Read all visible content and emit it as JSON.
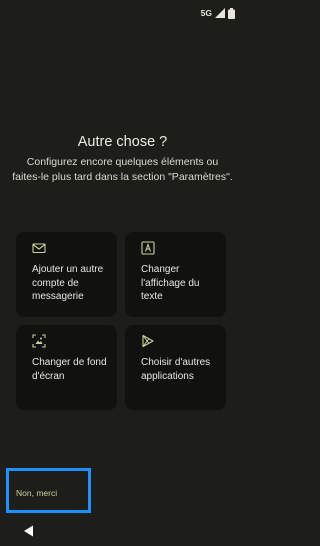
{
  "status_bar": {
    "network": "5G",
    "signal_icon": "signal-icon",
    "battery_icon": "battery-icon"
  },
  "page": {
    "title": "Autre chose ?",
    "subtitle": "Configurez encore quelques éléments ou faites-le plus tard dans la section \"Paramètres\"."
  },
  "cards": [
    {
      "label": "Ajouter un autre compte de messagerie",
      "icon": "mail-icon"
    },
    {
      "label": "Changer l'affichage du texte",
      "icon": "text-display-icon"
    },
    {
      "label": "Changer de fond d'écran",
      "icon": "wallpaper-icon"
    },
    {
      "label": "Choisir d'autres applications",
      "icon": "play-store-icon"
    }
  ],
  "footer": {
    "skip_label": "Non, merci",
    "back_icon": "back-icon"
  },
  "colors": {
    "background": "#1d1e1a",
    "card": "#111210",
    "accent": "#c9d39a",
    "highlight": "#1e90ff"
  }
}
